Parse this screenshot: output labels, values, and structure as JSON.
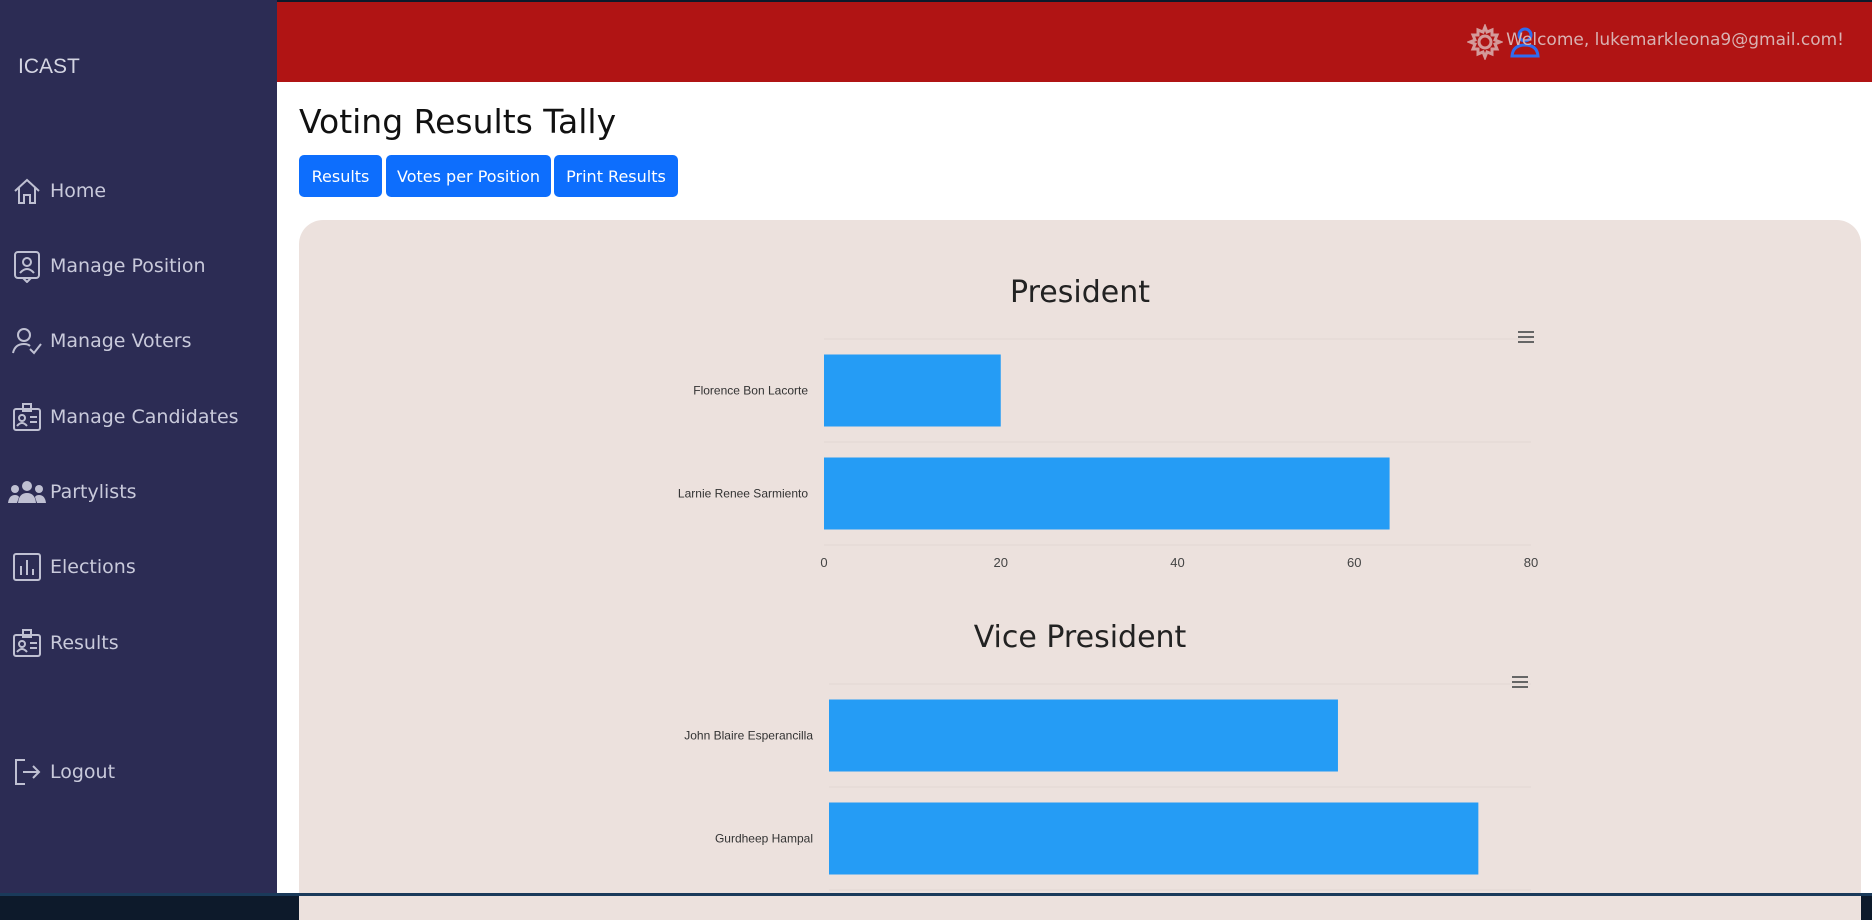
{
  "app": {
    "brand": "ICAST"
  },
  "sidebar": {
    "items": [
      {
        "label": "Home",
        "icon": "home-icon"
      },
      {
        "label": "Manage Position",
        "icon": "badge-icon"
      },
      {
        "label": "Manage Voters",
        "icon": "user-check-icon"
      },
      {
        "label": "Manage Candidates",
        "icon": "id-card-icon"
      },
      {
        "label": "Partylists",
        "icon": "group-icon"
      },
      {
        "label": "Elections",
        "icon": "bar-chart-icon"
      },
      {
        "label": "Results",
        "icon": "id-card-icon"
      },
      {
        "label": "Logout",
        "icon": "logout-icon"
      }
    ]
  },
  "header": {
    "welcome": "Welcome, lukemarkleona9@gmail.com!"
  },
  "page": {
    "title": "Voting Results Tally",
    "buttons": {
      "results": "Results",
      "votes_per_position": "Votes per Position",
      "print": "Print Results"
    }
  },
  "colors": {
    "sidebar": "#2c2c54",
    "topbar": "#b01414",
    "button": "#0d6efd",
    "bar": "#259cf5",
    "panel": "#ece1dd"
  },
  "chart_data": [
    {
      "type": "bar",
      "orientation": "horizontal",
      "title": "President",
      "categories": [
        "Florence Bon Lacorte",
        "Larnie Renee Sarmiento"
      ],
      "values": [
        20,
        64
      ],
      "xlim": [
        0,
        80
      ],
      "ticks": [
        "0",
        "20",
        "40",
        "60",
        "80"
      ]
    },
    {
      "type": "bar",
      "orientation": "horizontal",
      "title": "Vice President",
      "categories": [
        "John Blaire Esperancilla",
        "Gurdheep Hampal"
      ],
      "values": [
        58,
        74
      ],
      "xlim": [
        0,
        80
      ]
    }
  ]
}
